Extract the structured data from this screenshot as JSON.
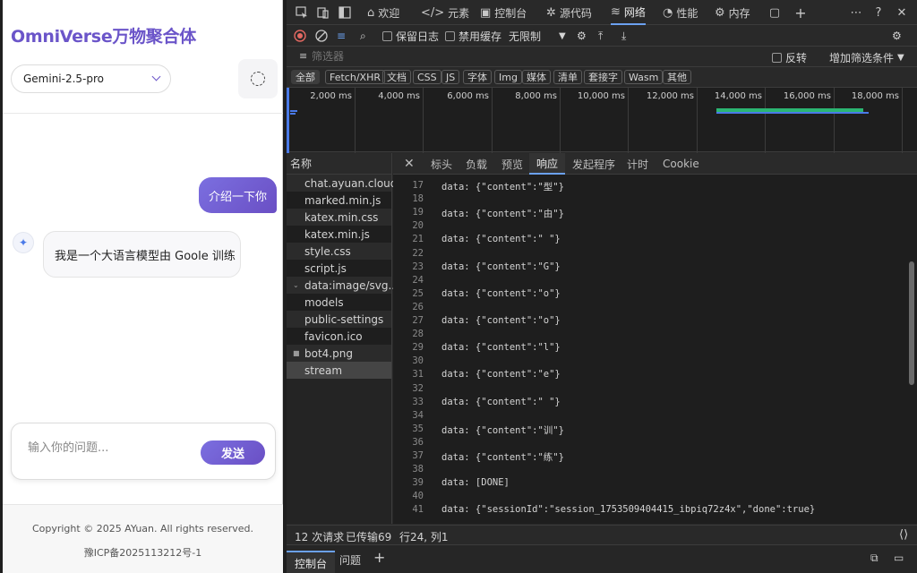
{
  "app": {
    "title": "OmniVerse万物聚合体",
    "model": "Gemini-2.5-pro",
    "messages": {
      "user": "介绍一下你",
      "bot": "我是一个大语言模型由 Goole 训练"
    },
    "input_placeholder": "输入你的问题...",
    "send_label": "发送",
    "footer": {
      "copyright": "Copyright © 2025 AYuan. All rights reserved.",
      "icp": "豫ICP备2025113212号-1"
    }
  },
  "devtools": {
    "tabs": [
      {
        "label": "欢迎",
        "icon": "home-icon"
      },
      {
        "label": "元素",
        "icon": "code-icon"
      },
      {
        "label": "控制台",
        "icon": "console-icon"
      },
      {
        "label": "源代码",
        "icon": "bug-icon"
      },
      {
        "label": "网络",
        "icon": "wifi-icon"
      },
      {
        "label": "性能",
        "icon": "gauge-icon"
      },
      {
        "label": "内存",
        "icon": "memory-icon"
      }
    ],
    "network_toolbar": {
      "preserve_log": "保留日志",
      "disable_cache": "禁用缓存",
      "throttle": "无限制"
    },
    "filter": {
      "placeholder": "筛选器",
      "invert": "反转",
      "more_filters": "增加筛选条件"
    },
    "type_filters": [
      "全部",
      "Fetch/XHR",
      "文档",
      "CSS",
      "JS",
      "字体",
      "Img",
      "媒体",
      "清单",
      "套接字",
      "Wasm",
      "其他"
    ],
    "timeline_ticks": [
      "2,000 ms",
      "4,000 ms",
      "6,000 ms",
      "8,000 ms",
      "10,000 ms",
      "12,000 ms",
      "14,000 ms",
      "16,000 ms",
      "18,000 ms"
    ],
    "names_header": "名称",
    "requests": [
      "chat.ayuan.cloud",
      "marked.min.js",
      "katex.min.css",
      "katex.min.js",
      "style.css",
      "script.js",
      "data:image/svg...",
      "models",
      "public-settings",
      "favicon.ico",
      "bot4.png",
      "stream"
    ],
    "detail_tabs": [
      "标头",
      "负载",
      "预览",
      "响应",
      "发起程序",
      "计时",
      "Cookie"
    ],
    "response_lines": [
      {
        "n": "17",
        "t": "data: {\"content\":\"型\"}"
      },
      {
        "n": "18",
        "t": ""
      },
      {
        "n": "19",
        "t": "data: {\"content\":\"由\"}"
      },
      {
        "n": "20",
        "t": ""
      },
      {
        "n": "21",
        "t": "data: {\"content\":\" \"}"
      },
      {
        "n": "22",
        "t": ""
      },
      {
        "n": "23",
        "t": "data: {\"content\":\"G\"}"
      },
      {
        "n": "24",
        "t": ""
      },
      {
        "n": "25",
        "t": "data: {\"content\":\"o\"}"
      },
      {
        "n": "26",
        "t": ""
      },
      {
        "n": "27",
        "t": "data: {\"content\":\"o\"}"
      },
      {
        "n": "28",
        "t": ""
      },
      {
        "n": "29",
        "t": "data: {\"content\":\"l\"}"
      },
      {
        "n": "30",
        "t": ""
      },
      {
        "n": "31",
        "t": "data: {\"content\":\"e\"}"
      },
      {
        "n": "32",
        "t": ""
      },
      {
        "n": "33",
        "t": "data: {\"content\":\" \"}"
      },
      {
        "n": "34",
        "t": ""
      },
      {
        "n": "35",
        "t": "data: {\"content\":\"训\"}"
      },
      {
        "n": "36",
        "t": ""
      },
      {
        "n": "37",
        "t": "data: {\"content\":\"练\"}"
      },
      {
        "n": "38",
        "t": ""
      },
      {
        "n": "39",
        "t": "data: [DONE]"
      },
      {
        "n": "40",
        "t": ""
      },
      {
        "n": "41",
        "t": "data: {\"sessionId\":\"session_1753509404415_ibpiq72z4x\",\"done\":true}"
      }
    ],
    "status": {
      "requests": "12 次请求",
      "transferred": "已传输69.5",
      "position": "行24, 列1"
    },
    "drawer_tabs": [
      "控制台",
      "问题"
    ]
  },
  "colors": {
    "accent": "#6b55c9",
    "devtools_bg": "#282828",
    "active_tab": "#6ba1f0"
  }
}
